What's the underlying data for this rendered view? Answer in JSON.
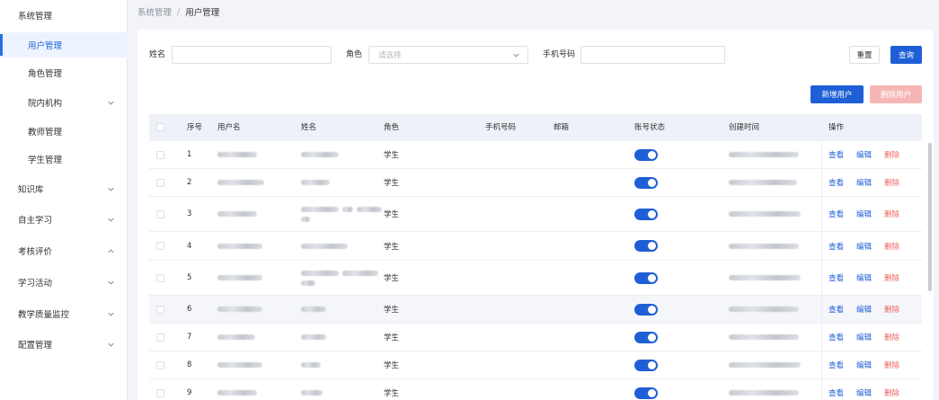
{
  "sidebar": {
    "items": [
      {
        "label": "系统管理",
        "type": "group",
        "chevron": false
      },
      {
        "label": "用户管理",
        "type": "sub",
        "active": true
      },
      {
        "label": "角色管理",
        "type": "sub"
      },
      {
        "label": "院内机构",
        "type": "sub",
        "chevron": "down"
      },
      {
        "label": "教师管理",
        "type": "sub"
      },
      {
        "label": "学生管理",
        "type": "sub"
      },
      {
        "label": "知识库",
        "type": "group",
        "chevron": "down"
      },
      {
        "label": "自主学习",
        "type": "group",
        "chevron": "down"
      },
      {
        "label": "考核评价",
        "type": "group",
        "chevron": "up"
      },
      {
        "label": "学习活动",
        "type": "group",
        "chevron": "down"
      },
      {
        "label": "教学质量监控",
        "type": "group",
        "chevron": "down"
      },
      {
        "label": "配置管理",
        "type": "group",
        "chevron": "down"
      }
    ]
  },
  "breadcrumb": {
    "parent": "系统管理",
    "separator": "/",
    "current": "用户管理"
  },
  "filters": {
    "name_label": "姓名",
    "name_value": "",
    "role_label": "角色",
    "role_placeholder": "请选择",
    "phone_label": "手机号码",
    "phone_value": "",
    "reset_label": "重置",
    "search_label": "查询"
  },
  "actions": {
    "add_label": "新增用户",
    "delete_label": "删除用户"
  },
  "table": {
    "headers": {
      "index": "序号",
      "username": "用户名",
      "name": "姓名",
      "role": "角色",
      "phone": "手机号码",
      "email": "邮箱",
      "status": "账号状态",
      "created": "创建时间",
      "ops": "操作"
    },
    "ops": {
      "view": "查看",
      "edit": "编辑",
      "delete": "删除"
    },
    "rows": [
      {
        "index": "1",
        "role": "学生",
        "status_on": true
      },
      {
        "index": "2",
        "role": "学生",
        "status_on": true
      },
      {
        "index": "3",
        "role": "学生",
        "status_on": true
      },
      {
        "index": "4",
        "role": "学生",
        "status_on": true
      },
      {
        "index": "5",
        "role": "学生",
        "status_on": true
      },
      {
        "index": "6",
        "role": "学生",
        "status_on": true
      },
      {
        "index": "7",
        "role": "学生",
        "status_on": true
      },
      {
        "index": "8",
        "role": "学生",
        "status_on": true
      },
      {
        "index": "9",
        "role": "学生",
        "status_on": true
      }
    ]
  },
  "colors": {
    "primary": "#1f5fd6",
    "danger": "#f0625f",
    "danger_disabled": "#f7b6b6",
    "header_bg": "#eef2f8"
  }
}
